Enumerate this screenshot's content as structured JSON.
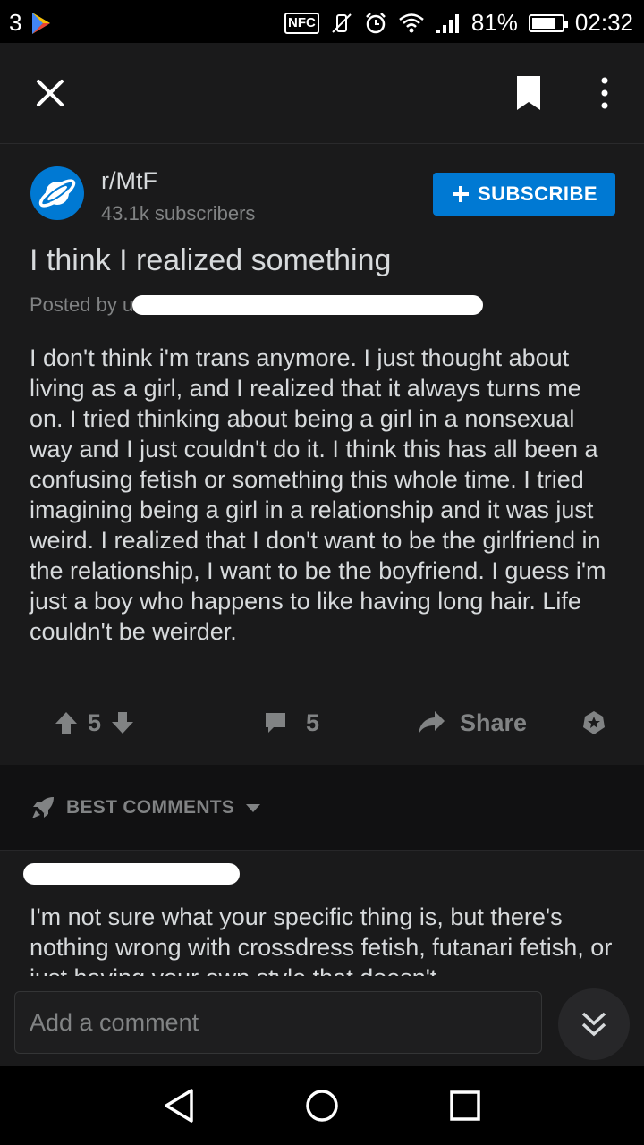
{
  "status_bar": {
    "notification_count": "3",
    "battery": "81%",
    "battery_level": 0.81,
    "time": "02:32",
    "nfc_label": "NFC"
  },
  "app_bar": {
    "icons": [
      "close-icon",
      "bookmark-icon",
      "more-vertical-icon"
    ]
  },
  "post": {
    "subreddit": "r/MtF",
    "subscribers": "43.1k subscribers",
    "subscribe_label": "SUBSCRIBE",
    "title": "I think I realized something",
    "posted_by": "Posted by u/",
    "body": "I don't think i'm trans anymore. I just thought about living as a girl, and I realized that it always turns me on. I tried thinking about being a girl in a nonsexual way and I just couldn't do it. I think this has all been a confusing fetish or something this whole time. I tried imagining being a girl in a relationship and it was just weird. I realized that I don't want to be the girlfriend in the relationship, I want to be the boyfriend. I guess i'm just a boy who happens to like having long hair. Life couldn't be weirder.",
    "votes": "5",
    "comments": "5",
    "share_label": "Share"
  },
  "comments_section": {
    "sort_label": "BEST COMMENTS",
    "first_comment": "I'm not sure what your specific thing is, but there's nothing wrong with crossdress fetish, futanari fetish, or just having your own style that doesn't"
  },
  "composer": {
    "placeholder": "Add a comment"
  },
  "colors": {
    "accent": "#0079d3",
    "background": "#1a1a1b",
    "muted": "#818384"
  }
}
